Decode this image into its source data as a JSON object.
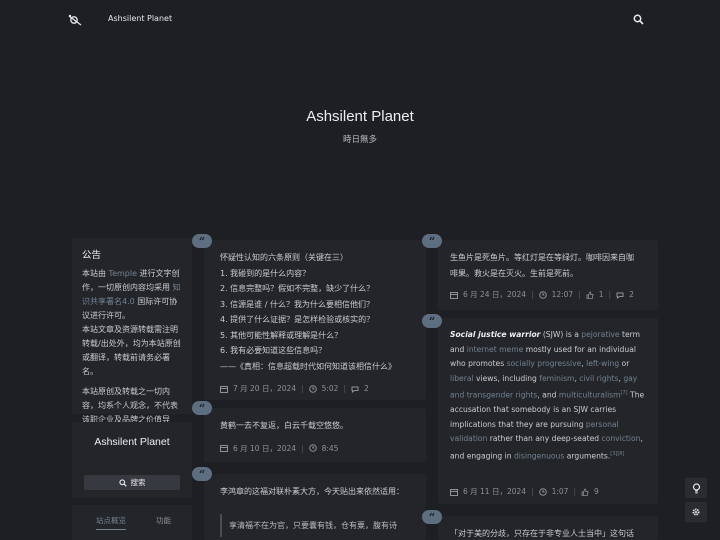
{
  "nav": {
    "site_name": "Ashsilent Planet"
  },
  "hero": {
    "title": "Ashsilent Planet",
    "subtitle": "時日無多"
  },
  "sidebar": {
    "notice_title": "公告",
    "notice_p1_a": "本站由 ",
    "notice_p1_link": "Temple",
    "notice_p1_b": " 进行文字创作，一切原创内容均采用 ",
    "notice_p1_link2": "知识共享署名4.0",
    "notice_p1_c": " 国际许可协议进行许可。",
    "notice_p2": "本站文章及资源转载需注明转载/出处外，均为本站原创或翻译，转载前请务必署名。",
    "notice_p3": "本站原创及转载之一切内容，均系个人观念，不代表该职企业及品牌之价值导向。悉知。",
    "brand_title": "Ashsilent Planet",
    "search_label": "搜索",
    "tab_overview": "站点概览",
    "tab_functions": "功能"
  },
  "posts_left": [
    {
      "lines": [
        "怀疑性认知的六条原则（关键在三）",
        "1. 我碰到的是什么内容？",
        "2. 信息完整吗？假如不完整，缺少了什么？",
        "3. 信源是谁 / 什么？我为什么要相信他们？",
        "4. 提供了什么证据？是怎样检验或核实的？",
        "5. 其他可能性解释或理解是什么？",
        "6. 我有必要知道这些信息吗？",
        "——《真相：信息超载时代如何知道该相信什么》"
      ],
      "date": "7 月 20 日，2024",
      "time": "5:02",
      "comments": "2"
    },
    {
      "lines": [
        "黄鹤一去不复返，白云千载空悠悠。"
      ],
      "date": "6 月 10 日，2024",
      "time": "8:45"
    },
    {
      "lines": [
        "李鸿章的这福对联朴素大方，今天贴出来依然适用："
      ],
      "quote": "享清福不在为官，只要囊有钱，仓有粟，腹有诗"
    }
  ],
  "posts_right": [
    {
      "lines": [
        "生鱼片是死鱼片。等红灯是在等绿灯。咖啡因来自咖啡果。救火是在灭火。生前是死前。"
      ],
      "date": "6 月 24 日，2024",
      "time": "12:07",
      "likes": "1",
      "comments": "2"
    },
    {
      "sjw": {
        "term": "Social justice warrior",
        "abbr": " (SJW) is a ",
        "l1": "pejorative",
        "t1": " term and ",
        "l2": "internet meme",
        "t2": " mostly used for an individual who promotes ",
        "l3": "socially progressive",
        "t3": ", ",
        "l4": "left-wing",
        "t4": " or ",
        "l5": "liberal",
        "t5": " views, including ",
        "l6": "feminism",
        "t6": ", ",
        "l7": "civil rights",
        "t7": ", ",
        "l8": "gay and transgender rights",
        "t8": ", and ",
        "l9": "multiculturalism",
        "ref1": "[7]",
        "t9": " The accusation that somebody is an SJW carries implications that they are pursuing ",
        "l10": "personal validation",
        "t10": " rather than any deep-seated ",
        "l11": "conviction",
        "t11": ", and engaging in ",
        "l12": "disingenuous",
        "t12": " arguments.",
        "ref2": "[3][8]"
      },
      "date": "6 月 11 日，2024",
      "time": "1:07",
      "likes": "9"
    },
    {
      "lines": [
        "「对于美的分歧，只存在于非专业人士当中」这句话"
      ]
    }
  ],
  "colors": {
    "bg": "#1e1f23",
    "card": "#242529",
    "accent": "#6f8396",
    "badge": "#5c6e80"
  }
}
